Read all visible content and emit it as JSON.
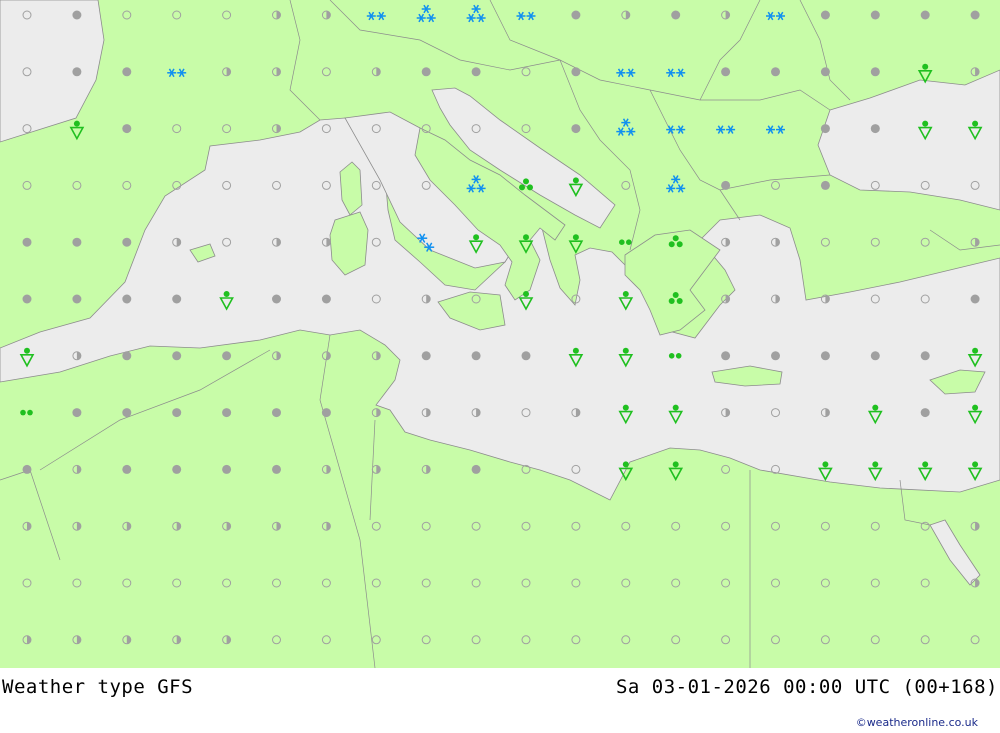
{
  "footer": {
    "title": "Weather type   GFS",
    "datetime": "Sa 03-01-2026 00:00 UTC (00+168)",
    "credit": "©weatheronline.co.uk"
  },
  "colors": {
    "land": "#c8fca8",
    "sea": "#ececec",
    "border": "#8c8c8c",
    "rain": "#20c020",
    "snow": "#1090f0",
    "cloud": "#a0a0a0"
  },
  "legend_codes": {
    "C": "overcast",
    "P": "partly cloudy",
    "O": "clear",
    "S": "snow",
    "F": "heavy snow",
    "R": "shower",
    "D": "rain",
    "d": "light rain"
  },
  "station_grid": [
    "OCOOOPPSFFSCPCPSCCCC",
    "OCCSPPOPCCOCSSCCCCRP",
    "ORCOOPOOOOOCFSSSCCRR",
    "OOOOOOOOOFDROFCOCOOO",
    "CCCPOPPOMRRRdDPPOOOP",
    "CCCCRCCOPORORDPPPOOC",
    "RPCCCPPPCCCRRdCCCCCR",
    "dCCCCCCPPPOPRRPOPRCR",
    "CPCCCCPPPCOORROORRRR",
    "PPPPPPPOOOOOOOOOOOOP",
    "OOOOOOOOOOOOOOOOOOOP",
    "PPPPPOOOOOOOOOOOOOOO"
  ]
}
